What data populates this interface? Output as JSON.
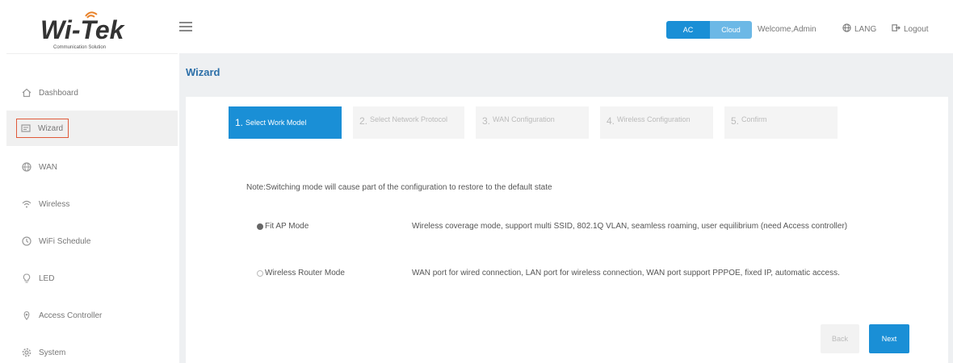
{
  "header": {
    "logo_text": "Wi-Tek",
    "logo_tagline": "Communication Solution",
    "mode_ac": "AC",
    "mode_cloud": "Cloud",
    "welcome": "Welcome,Admin",
    "lang": "LANG",
    "logout": "Logout"
  },
  "sidebar": {
    "items": [
      {
        "label": "Dashboard",
        "icon": "home-icon"
      },
      {
        "label": "Wizard",
        "icon": "wizard-icon",
        "active": true
      },
      {
        "label": "WAN",
        "icon": "globe-icon"
      },
      {
        "label": "Wireless",
        "icon": "wifi-icon"
      },
      {
        "label": "WiFi Schedule",
        "icon": "clock-icon"
      },
      {
        "label": "LED",
        "icon": "bulb-icon"
      },
      {
        "label": "Access Controller",
        "icon": "location-icon"
      },
      {
        "label": "System",
        "icon": "gear-icon"
      }
    ]
  },
  "main": {
    "title": "Wizard",
    "steps": [
      {
        "num": "1.",
        "label": "Select Work Model"
      },
      {
        "num": "2.",
        "label": "Select Network Protocol"
      },
      {
        "num": "3.",
        "label": "WAN Configuration"
      },
      {
        "num": "4.",
        "label": "Wireless Configuration"
      },
      {
        "num": "5.",
        "label": "Confirm"
      }
    ],
    "note": "Note:Switching mode will cause part of the configuration to restore to the default state",
    "options": [
      {
        "label": "Fit AP Mode",
        "checked": true,
        "desc": "Wireless coverage mode, support multi SSID, 802.1Q VLAN, seamless roaming, user equilibrium (need Access controller)"
      },
      {
        "label": "Wireless Router Mode",
        "checked": false,
        "desc": "WAN port for wired connection, LAN port for wireless connection, WAN port support PPPOE, fixed IP, automatic access."
      }
    ],
    "back_label": "Back",
    "next_label": "Next"
  },
  "colors": {
    "accent": "#1a8fd6",
    "highlight": "#e05a3a",
    "title": "#2c6fa8"
  }
}
